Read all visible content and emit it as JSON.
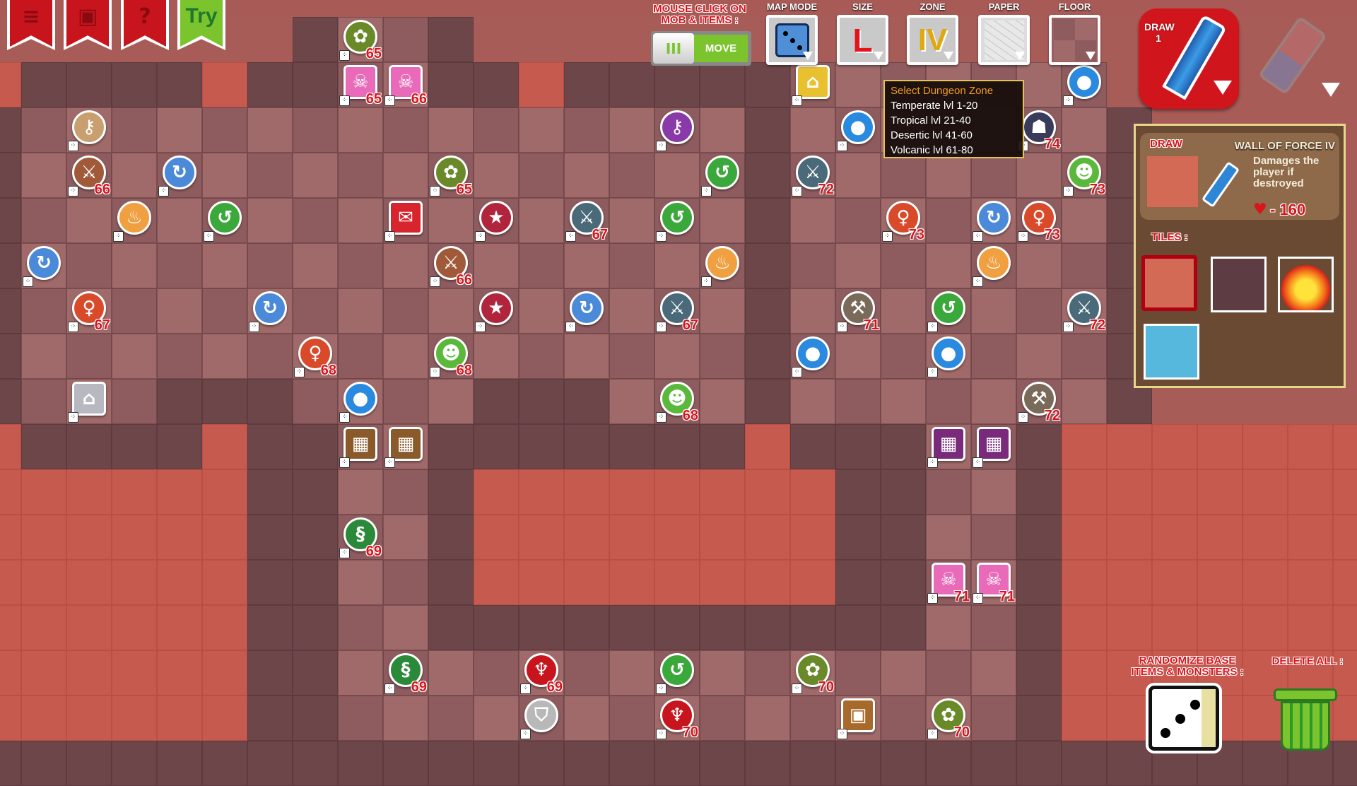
{
  "top_left_menu": [
    {
      "name": "menu",
      "icon": "hamburger-icon",
      "label": "≡"
    },
    {
      "name": "save",
      "icon": "floppy-disk-icon",
      "label": "▣"
    },
    {
      "name": "help",
      "icon": "question-icon",
      "label": "?"
    },
    {
      "name": "try",
      "icon": "try-ribbon",
      "label": "Try"
    }
  ],
  "toolbar": {
    "mouse_click_label": "MOUSE CLICK ON MOB & ITEMS :",
    "toggle_value": "MOVE",
    "toggle_knob": "III",
    "map_mode_label": "MAP MODE",
    "size_label": "SIZE",
    "size_value": "L",
    "zone_label": "ZONE",
    "zone_value": "IV",
    "paper_label": "PAPER",
    "floor_label": "FLOOR",
    "draw_label": "DRAW 1"
  },
  "tooltip": {
    "title": "Select Dungeon Zone",
    "options": [
      "Temperate lvl 1-20",
      "Tropical lvl 21-40",
      "Desertic lvl 41-60",
      "Volcanic lvl 61-80"
    ]
  },
  "panel": {
    "draw_label": "DRAW",
    "tile_name": "WALL OF FORCE IV",
    "description": "Damages the player if destroyed",
    "damage": "- 160",
    "tiles_label": "TILES :",
    "tiles": [
      "wall-of-force",
      "dark-floor",
      "fire",
      "water"
    ],
    "selected_tile": "wall-of-force"
  },
  "bottom": {
    "randomize_label": "RANDOMIZE BASE ITEMS & MONSTERS :",
    "delete_label": "DELETE ALL :"
  },
  "entities": [
    {
      "type": "plant-monster",
      "level": "65"
    },
    {
      "type": "pink-chest",
      "level": "65"
    },
    {
      "type": "pink-chest",
      "level": "66"
    },
    {
      "type": "key",
      "level": ""
    },
    {
      "type": "purple-key",
      "level": ""
    },
    {
      "type": "shop",
      "level": ""
    },
    {
      "type": "blue-drop",
      "level": ""
    },
    {
      "type": "blue-drop",
      "level": ""
    },
    {
      "type": "ghost",
      "level": "74"
    },
    {
      "type": "axeman",
      "level": "66"
    },
    {
      "type": "blue-swirl",
      "level": ""
    },
    {
      "type": "plant-monster",
      "level": "65"
    },
    {
      "type": "green-orb",
      "level": ""
    },
    {
      "type": "orc",
      "level": "72"
    },
    {
      "type": "green-monster",
      "level": "73"
    },
    {
      "type": "chicken",
      "level": ""
    },
    {
      "type": "green-orb",
      "level": ""
    },
    {
      "type": "red-book",
      "level": ""
    },
    {
      "type": "pentagram",
      "level": ""
    },
    {
      "type": "orc",
      "level": "67"
    },
    {
      "type": "green-orb",
      "level": ""
    },
    {
      "type": "fire-woman",
      "level": "73"
    },
    {
      "type": "blue-swirl",
      "level": ""
    },
    {
      "type": "fire-woman",
      "level": "73"
    },
    {
      "type": "blue-swirl",
      "level": ""
    },
    {
      "type": "axeman",
      "level": "66"
    },
    {
      "type": "chicken",
      "level": ""
    },
    {
      "type": "chicken",
      "level": ""
    },
    {
      "type": "fire-woman",
      "level": "67"
    },
    {
      "type": "blue-swirl",
      "level": ""
    },
    {
      "type": "pentagram",
      "level": ""
    },
    {
      "type": "blue-swirl",
      "level": ""
    },
    {
      "type": "orc",
      "level": "67"
    },
    {
      "type": "dwarf",
      "level": "71"
    },
    {
      "type": "green-orb",
      "level": ""
    },
    {
      "type": "orc",
      "level": "72"
    },
    {
      "type": "fire-woman",
      "level": "68"
    },
    {
      "type": "green-monster",
      "level": "68"
    },
    {
      "type": "blue-drop",
      "level": ""
    },
    {
      "type": "blue-drop",
      "level": ""
    },
    {
      "type": "temple",
      "level": ""
    },
    {
      "type": "blue-drop",
      "level": ""
    },
    {
      "type": "green-monster",
      "level": "68"
    },
    {
      "type": "dwarf",
      "level": "72"
    },
    {
      "type": "wooden-door",
      "level": ""
    },
    {
      "type": "wooden-door",
      "level": ""
    },
    {
      "type": "purple-door",
      "level": ""
    },
    {
      "type": "purple-door",
      "level": ""
    },
    {
      "type": "snake",
      "level": "69"
    },
    {
      "type": "pink-chest",
      "level": "71"
    },
    {
      "type": "pink-chest",
      "level": "71"
    },
    {
      "type": "snake",
      "level": "69"
    },
    {
      "type": "red-devil",
      "level": "69"
    },
    {
      "type": "green-orb",
      "level": ""
    },
    {
      "type": "plant-monster",
      "level": "70"
    },
    {
      "type": "shield",
      "level": ""
    },
    {
      "type": "red-devil",
      "level": "70"
    },
    {
      "type": "treasure-chest",
      "level": ""
    },
    {
      "type": "plant-monster",
      "level": "70"
    }
  ],
  "colors": {
    "accent_red": "#d8141c",
    "accent_green": "#7cc42e",
    "tooltip_title": "#f39a1c",
    "wall": "#c65a4f",
    "floor": "#8e5c5f"
  }
}
